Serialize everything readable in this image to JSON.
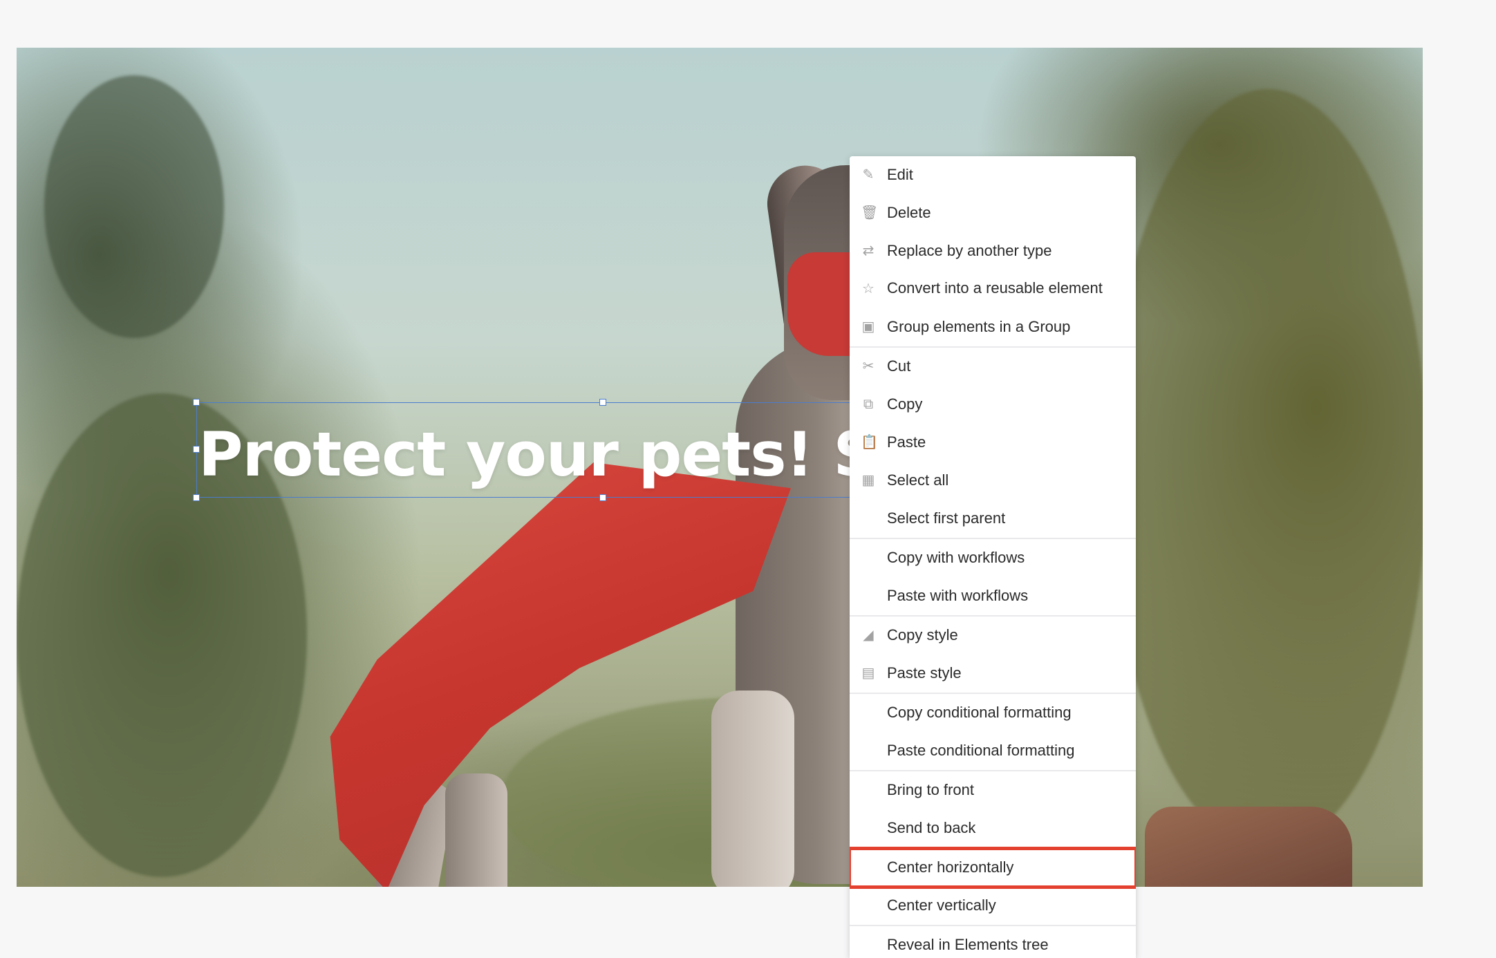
{
  "canvas": {
    "headline_text": "Protect your pets! Sign",
    "accent_color": "#4a7ccd",
    "highlight_color": "#e4402f"
  },
  "context_menu": {
    "groups": [
      [
        {
          "label": "Edit",
          "icon": "edit-icon",
          "glyph": "✎"
        },
        {
          "label": "Delete",
          "icon": "trash-icon",
          "glyph": "🗑"
        },
        {
          "label": "Replace by another type",
          "icon": "swap-arrows-icon",
          "glyph": "⇄"
        },
        {
          "label": "Convert into a reusable element",
          "icon": "star-icon",
          "glyph": "☆"
        },
        {
          "label": "Group elements in a Group",
          "icon": "group-frame-icon",
          "glyph": "▣"
        }
      ],
      [
        {
          "label": "Cut",
          "icon": "scissors-icon",
          "glyph": "✂"
        },
        {
          "label": "Copy",
          "icon": "copy-icon",
          "glyph": "⧉"
        },
        {
          "label": "Paste",
          "icon": "paste-icon",
          "glyph": "📋"
        },
        {
          "label": "Select all",
          "icon": "grid-icon",
          "glyph": "▦"
        },
        {
          "label": "Select first parent",
          "icon": "",
          "glyph": ""
        }
      ],
      [
        {
          "label": "Copy with workflows",
          "icon": "",
          "glyph": ""
        },
        {
          "label": "Paste with workflows",
          "icon": "",
          "glyph": ""
        }
      ],
      [
        {
          "label": "Copy style",
          "icon": "eraser-icon",
          "glyph": "◢"
        },
        {
          "label": "Paste style",
          "icon": "document-icon",
          "glyph": "▤"
        }
      ],
      [
        {
          "label": "Copy conditional formatting",
          "icon": "",
          "glyph": ""
        },
        {
          "label": "Paste conditional formatting",
          "icon": "",
          "glyph": ""
        }
      ],
      [
        {
          "label": "Bring to front",
          "icon": "",
          "glyph": ""
        },
        {
          "label": "Send to back",
          "icon": "",
          "glyph": ""
        }
      ],
      [
        {
          "label": "Center horizontally",
          "icon": "",
          "glyph": "",
          "highlighted": true
        },
        {
          "label": "Center vertically",
          "icon": "",
          "glyph": ""
        }
      ],
      [
        {
          "label": "Reveal in Elements tree",
          "icon": "",
          "glyph": ""
        }
      ]
    ]
  }
}
